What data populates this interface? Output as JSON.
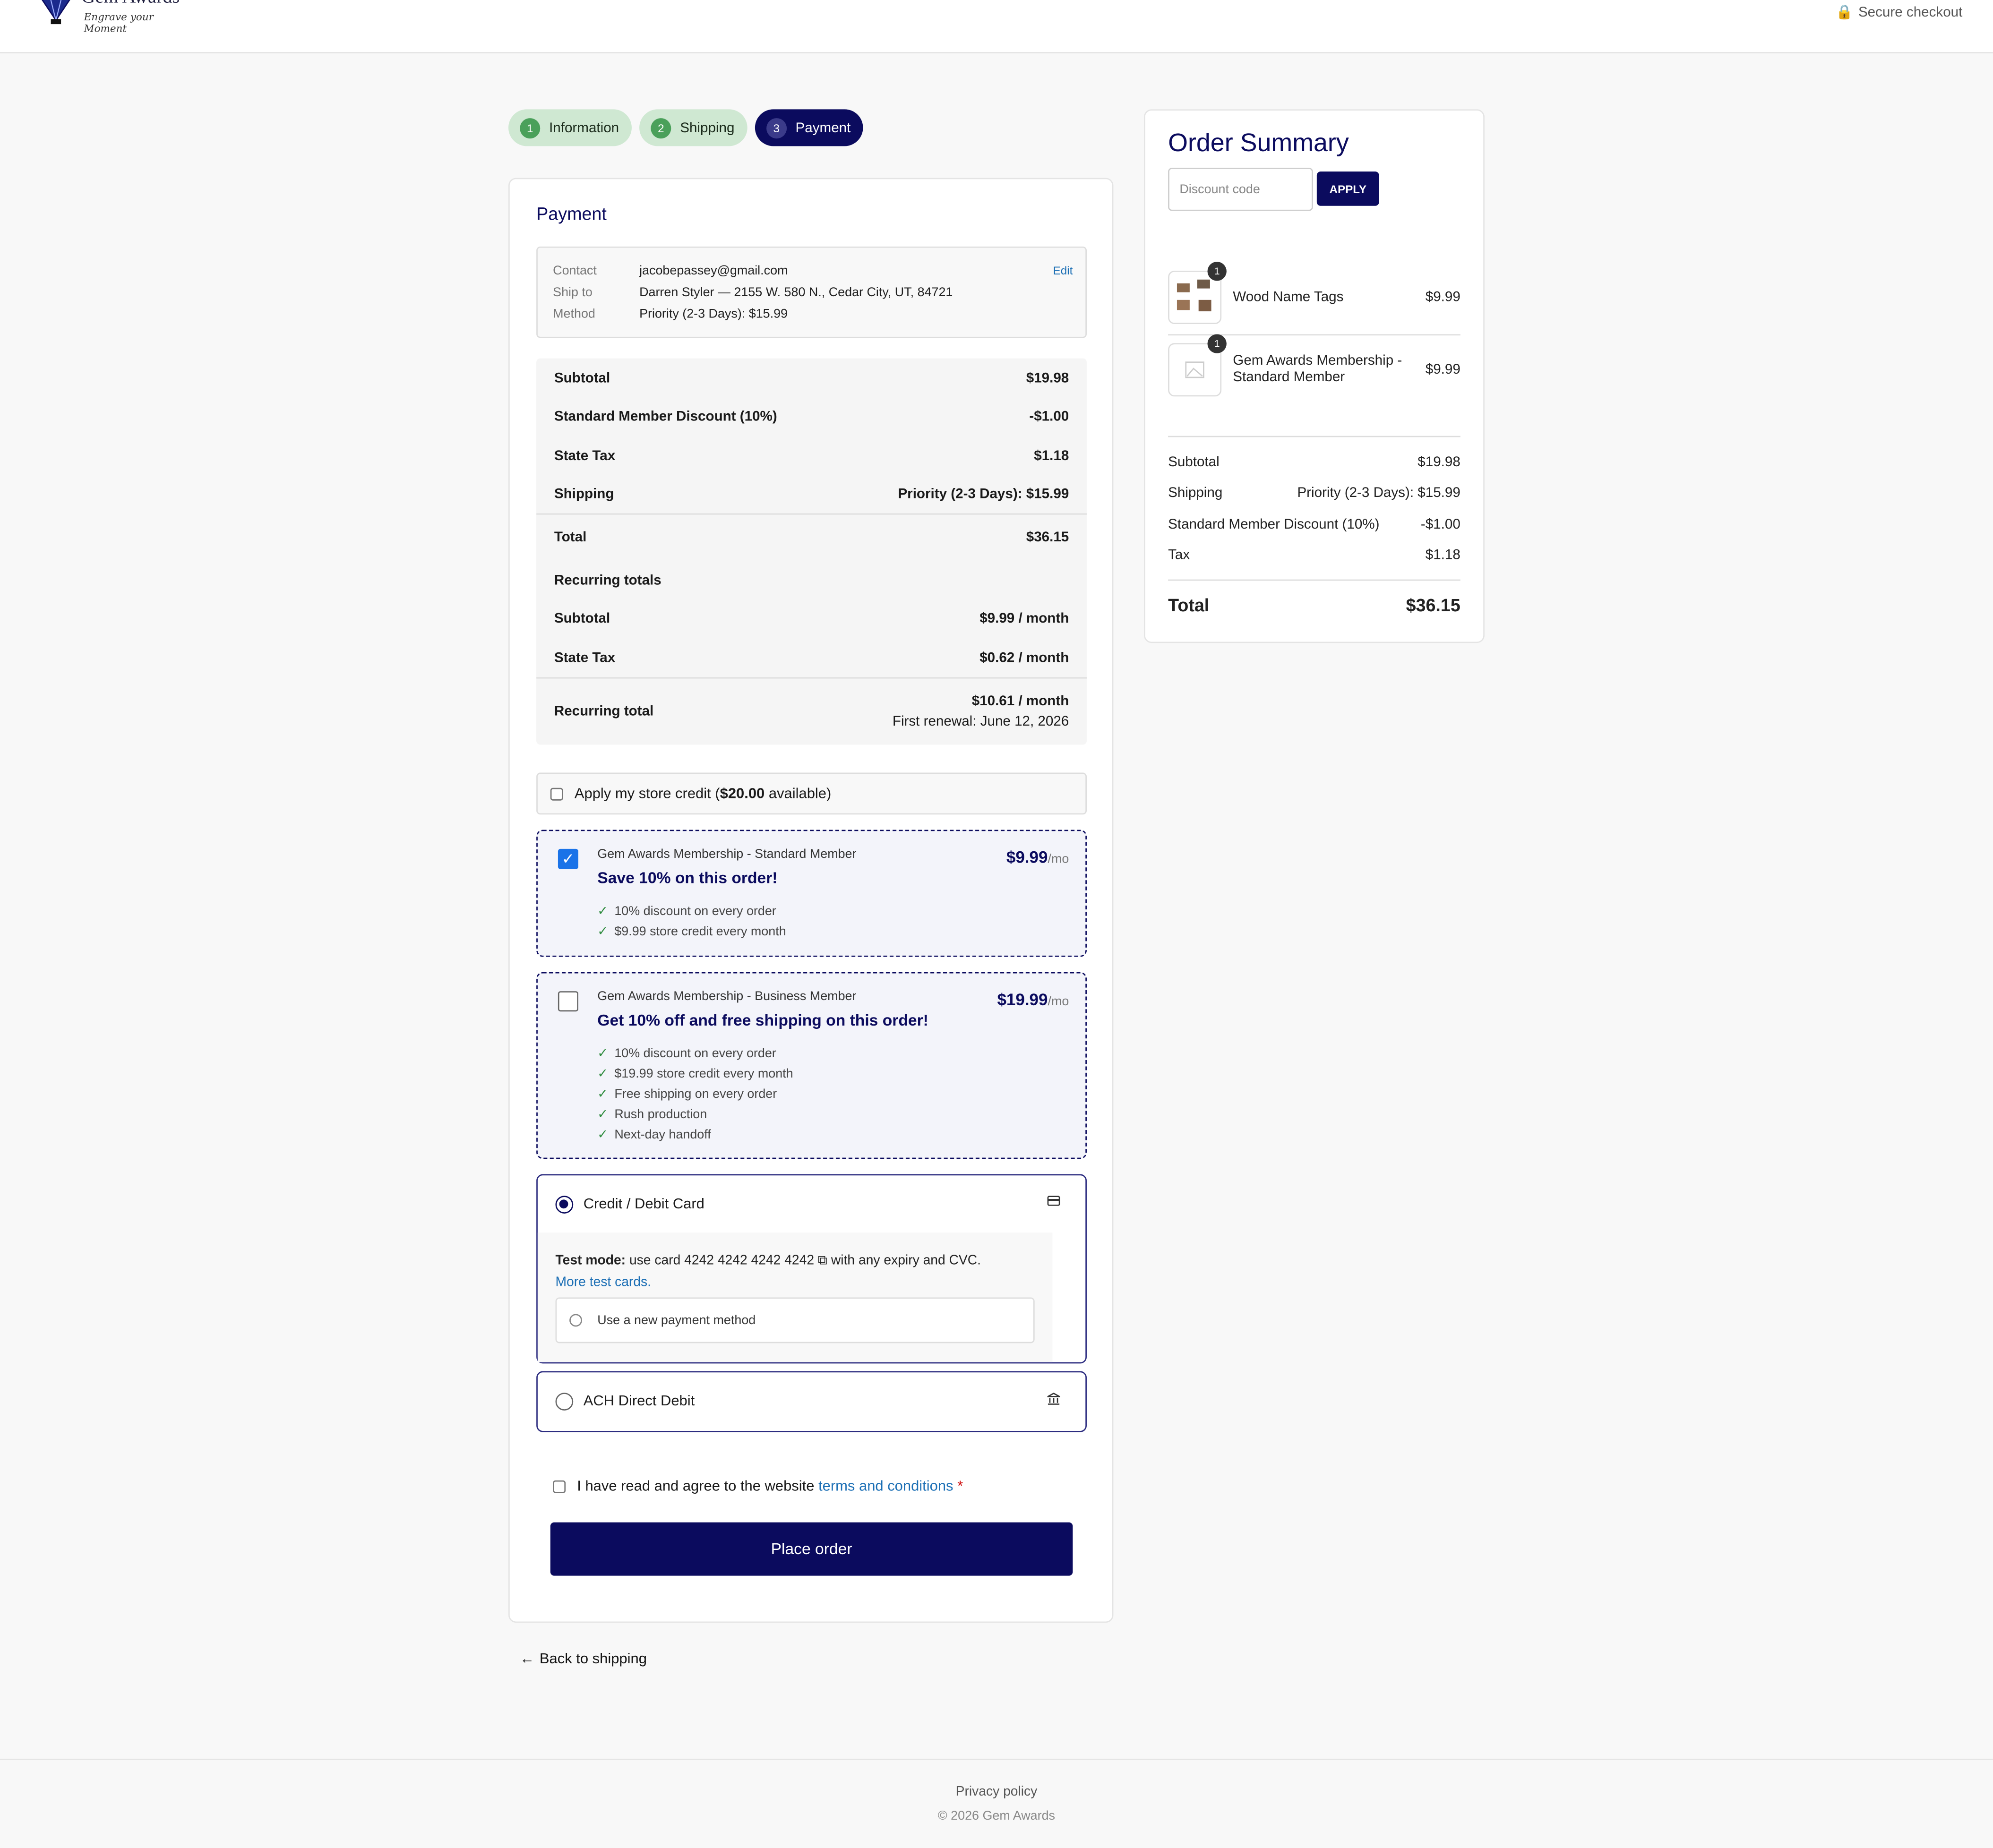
{
  "brand": {
    "name": "Gem Awards",
    "tagline": "Engrave your Moment"
  },
  "header": {
    "secure_label": "Secure checkout"
  },
  "steps": [
    {
      "num": "1",
      "label": "Information"
    },
    {
      "num": "2",
      "label": "Shipping"
    },
    {
      "num": "3",
      "label": "Payment"
    }
  ],
  "payment": {
    "title": "Payment",
    "contact": {
      "contact_label": "Contact",
      "contact_value": "jacobepassey@gmail.com",
      "ship_label": "Ship to",
      "ship_value": "Darren Styler — 2155 W. 580 N., Cedar City, UT, 84721",
      "method_label": "Method",
      "method_value": "Priority (2-3 Days): $15.99",
      "edit_label": "Edit"
    },
    "totals": {
      "subtotal_label": "Subtotal",
      "subtotal": "$19.98",
      "discount_label": "Standard Member Discount (10%)",
      "discount": "-$1.00",
      "tax_label": "State Tax",
      "tax": "$1.18",
      "shipping_label": "Shipping",
      "shipping": "Priority (2-3 Days): $15.99",
      "total_label": "Total",
      "total": "$36.15",
      "recurring_heading": "Recurring totals",
      "r_subtotal_label": "Subtotal",
      "r_subtotal": "$9.99 / month",
      "r_tax_label": "State Tax",
      "r_tax": "$0.62 / month",
      "r_total_label": "Recurring total",
      "r_total": "$10.61 / month",
      "r_renewal": "First renewal: June 12, 2026"
    },
    "store_credit": {
      "prefix": "Apply my store credit (",
      "amount": "$20.00",
      "suffix": " available)"
    },
    "memberships": [
      {
        "name": "Gem Awards Membership - Standard Member",
        "headline": "Save 10% on this order!",
        "price": "$9.99",
        "per": "/mo",
        "checked": true,
        "benefits": [
          "10% discount on every order",
          "$9.99 store credit every month"
        ]
      },
      {
        "name": "Gem Awards Membership - Business Member",
        "headline": "Get 10% off and free shipping on this order!",
        "price": "$19.99",
        "per": "/mo",
        "checked": false,
        "benefits": [
          "10% discount on every order",
          "$19.99 store credit every month",
          "Free shipping on every order",
          "Rush production",
          "Next-day handoff"
        ]
      }
    ],
    "methods": {
      "card_label": "Credit / Debit Card",
      "card_icon": "credit-card-icon",
      "test_mode_label": "Test mode:",
      "test_mode_text_a": " use card ",
      "test_card_number": "4242 4242 4242 4242",
      "test_mode_text_b": " with any expiry and CVC.",
      "more_test_cards": "More test cards.",
      "new_method_label": "Use a new payment method",
      "ach_label": "ACH Direct Debit",
      "ach_icon": "bank-icon"
    },
    "terms": {
      "prefix": "I have read and agree to the website ",
      "link": "terms and conditions",
      "required": "*"
    },
    "place_order": "Place order",
    "back": "Back to shipping"
  },
  "summary": {
    "title": "Order Summary",
    "discount_placeholder": "Discount code",
    "apply_label": "APPLY",
    "items": [
      {
        "name": "Wood Name Tags",
        "qty": "1",
        "price": "$9.99"
      },
      {
        "name": "Gem Awards Membership - Standard Member",
        "qty": "1",
        "price": "$9.99"
      }
    ],
    "subtotal_label": "Subtotal",
    "subtotal": "$19.98",
    "shipping_label": "Shipping",
    "shipping": "Priority (2-3 Days): $15.99",
    "discount_label": "Standard Member Discount (10%)",
    "discount": "-$1.00",
    "tax_label": "Tax",
    "tax": "$1.18",
    "total_label": "Total",
    "total": "$36.15"
  },
  "footer": {
    "privacy": "Privacy policy",
    "copyright": "© 2026 Gem Awards"
  },
  "colors": {
    "primary": "#0b0b5e",
    "link": "#1c6fb5",
    "success": "#4aa05a"
  }
}
